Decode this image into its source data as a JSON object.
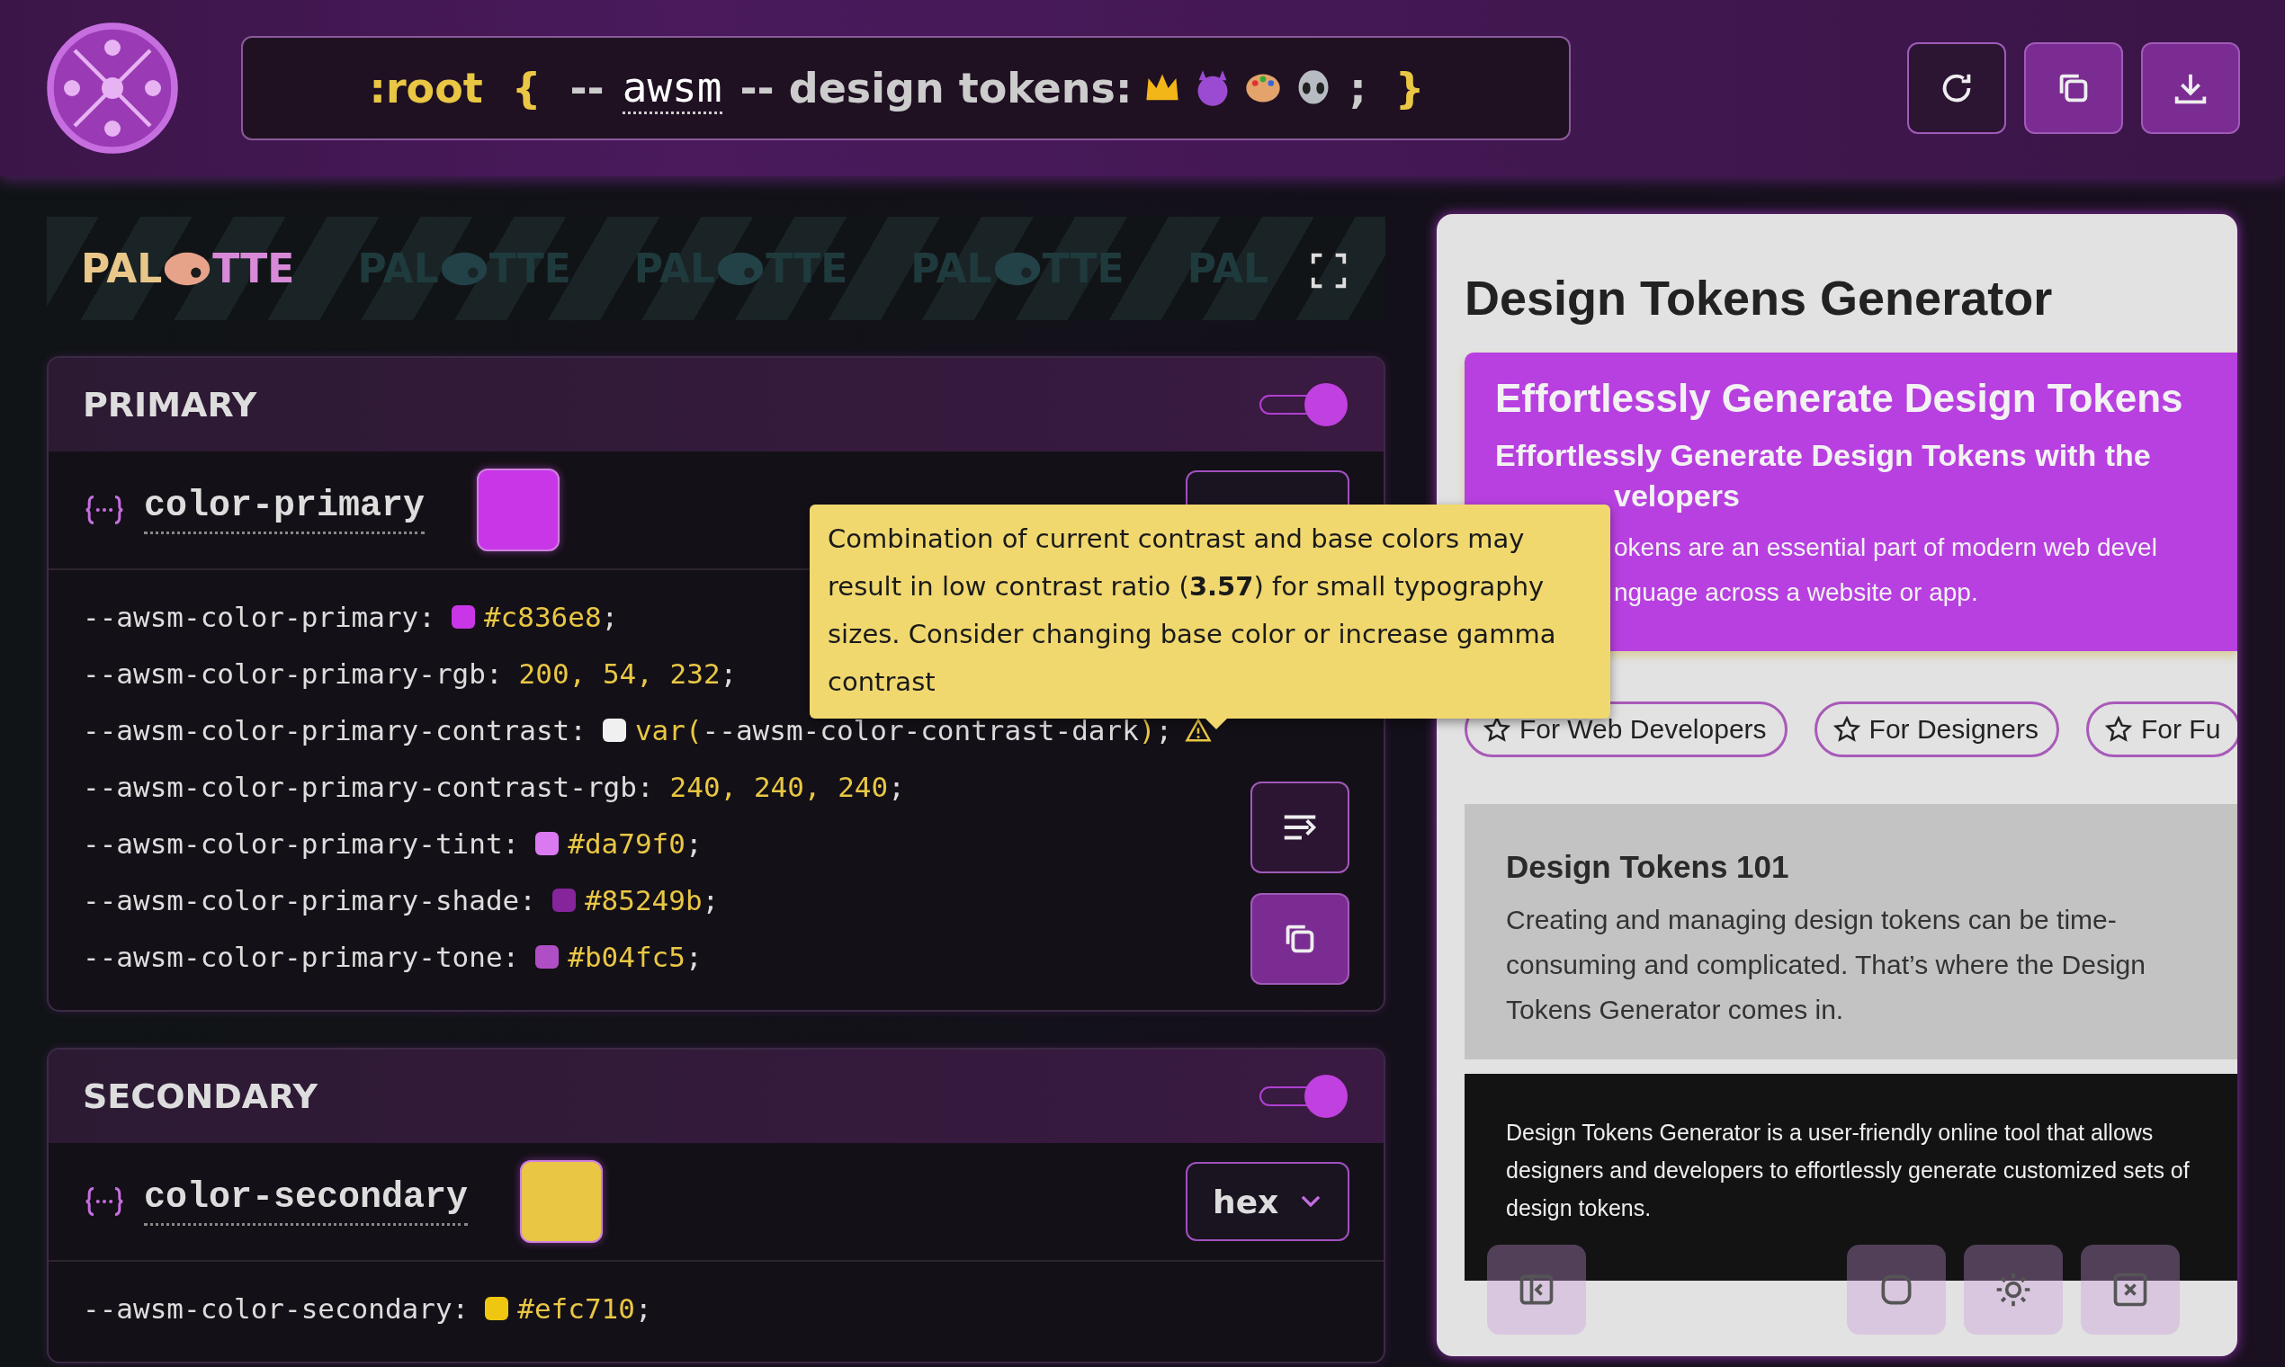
{
  "header": {
    "prefix": ":root",
    "open_brace": "{",
    "dashes": "--",
    "prefix_value": "awsm",
    "middle": "-- design tokens:",
    "semicolon": ";",
    "close_brace": "}"
  },
  "banner": {
    "items": [
      {
        "before": "PAL",
        "after": "TTE",
        "faded": false
      },
      {
        "before": "PAL",
        "after": "TTE",
        "faded": true
      },
      {
        "before": "PAL",
        "after": "TTE",
        "faded": true
      },
      {
        "before": "PAL",
        "after": "TTE",
        "faded": true
      },
      {
        "before": "PAL",
        "faded": true
      }
    ]
  },
  "sections": [
    {
      "title": "PRIMARY",
      "on": true,
      "token": "color-primary",
      "color": "#c836e8",
      "lines": [
        {
          "name": "--awsm-color-primary:",
          "color": "#c836e8",
          "warning": false,
          "parts": [
            {
              "text": "#c836e8",
              "kind": "value"
            },
            {
              "text": ";",
              "kind": "punct"
            }
          ]
        },
        {
          "name": "--awsm-color-primary-rgb:",
          "warning": false,
          "parts": [
            {
              "text": "200, 54, 232",
              "kind": "value"
            },
            {
              "text": ";",
              "kind": "punct"
            }
          ]
        },
        {
          "name": "--awsm-color-primary-contrast:",
          "color": "#f0f0f0",
          "warning": true,
          "parts": [
            {
              "text": "var(",
              "kind": "value"
            },
            {
              "text": "--awsm-color-contrast-dark",
              "kind": "punct"
            },
            {
              "text": ")",
              "kind": "value"
            },
            {
              "text": ";",
              "kind": "punct"
            }
          ]
        },
        {
          "name": "--awsm-color-primary-contrast-rgb:",
          "warning": false,
          "parts": [
            {
              "text": "240, 240, 240",
              "kind": "value"
            },
            {
              "text": ";",
              "kind": "punct"
            }
          ]
        },
        {
          "name": "--awsm-color-primary-tint:",
          "color": "#da79f0",
          "warning": false,
          "parts": [
            {
              "text": "#da79f0",
              "kind": "value"
            },
            {
              "text": ";",
              "kind": "punct"
            }
          ]
        },
        {
          "name": "--awsm-color-primary-shade:",
          "color": "#85249b",
          "warning": false,
          "parts": [
            {
              "text": "#85249b",
              "kind": "value"
            },
            {
              "text": ";",
              "kind": "punct"
            }
          ]
        },
        {
          "name": "--awsm-color-primary-tone:",
          "color": "#b04fc5",
          "warning": false,
          "parts": [
            {
              "text": "#b04fc5",
              "kind": "value"
            },
            {
              "text": ";",
              "kind": "punct"
            }
          ]
        }
      ],
      "tooltip": "Combination of current contrast and base colors may result in low contrast ratio (**3.57**) for small typography sizes. Consider changing base color or increase gamma contrast"
    },
    {
      "title": "SECONDARY",
      "on": true,
      "token": "color-secondary",
      "color": "#e9c744",
      "format": "hex",
      "lines": [
        {
          "name": "--awsm-color-secondary:",
          "color": "#efc710",
          "warning": false,
          "parts": [
            {
              "text": "#efc710",
              "kind": "value"
            },
            {
              "text": ";",
              "kind": "punct"
            }
          ]
        }
      ]
    }
  ],
  "preview": {
    "title": "Design Tokens Generator",
    "hero": {
      "title": "Effortlessly Generate Design Tokens",
      "subtitle_line_1": "Effortlessly Generate Design Tokens with the",
      "subtitle_line_2": "velopers",
      "text_line_1": "okens are an essential part of modern web devel",
      "text_line_2": "nguage across a website or app."
    },
    "chips": [
      "For Web Developers",
      "For Designers",
      "For Fu"
    ],
    "card": {
      "title": "Design Tokens 101",
      "text": "Creating and managing design tokens can be time-consuming and complicated. That’s where the Design Tokens Generator comes in."
    },
    "dark_card": {
      "text": "Design Tokens Generator is a user-friendly online tool that allows designers and developers to effortlessly generate customized sets of design tokens."
    }
  }
}
